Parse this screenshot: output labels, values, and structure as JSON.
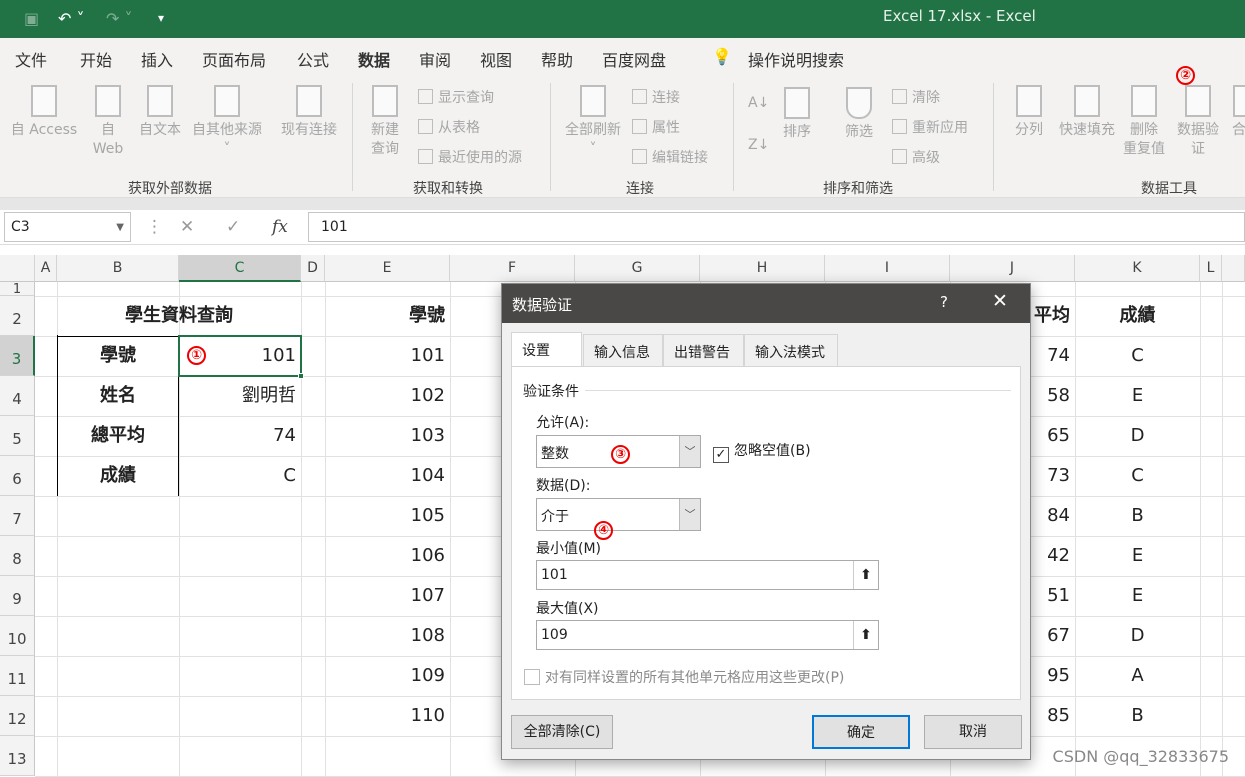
{
  "titlebar": {
    "title": "Excel 17.xlsx  -  Excel",
    "quick_access": [
      "save-icon",
      "undo-icon",
      "redo-icon",
      "customize-icon"
    ]
  },
  "menu_tabs": [
    "文件",
    "开始",
    "插入",
    "页面布局",
    "公式",
    "数据",
    "审阅",
    "视图",
    "帮助",
    "百度网盘"
  ],
  "active_tab": "数据",
  "tell_me": "操作说明搜索",
  "ribbon": {
    "get_external": {
      "label": "获取外部数据",
      "items": [
        "自 Access",
        "自\nWeb",
        "自文本",
        "自其他来源",
        "现有连接"
      ]
    },
    "get_transform": {
      "label": "获取和转换",
      "new_query": "新建\n查询",
      "small": [
        "显示查询",
        "从表格",
        "最近使用的源"
      ]
    },
    "connections": {
      "label": "连接",
      "refresh": "全部刷新",
      "small": [
        "连接",
        "属性",
        "编辑链接"
      ]
    },
    "sort_filter": {
      "label": "排序和筛选",
      "sort": "排序",
      "filter": "筛选",
      "small": [
        "清除",
        "重新应用",
        "高级"
      ]
    },
    "data_tools": {
      "label": "数据工具",
      "items": [
        "分列",
        "快速填充",
        "删除\n重复值",
        "数据验\n证",
        "合并"
      ]
    }
  },
  "formula_bar": {
    "name_box": "C3",
    "formula": "101",
    "fx": "fx"
  },
  "columns": [
    "A",
    "B",
    "C",
    "D",
    "E",
    "F",
    "G",
    "H",
    "I",
    "J",
    "K",
    "L"
  ],
  "rows": [
    "1",
    "2",
    "3",
    "4",
    "5",
    "6",
    "7",
    "8",
    "9",
    "10",
    "11",
    "12",
    "13"
  ],
  "lookup": {
    "title": "學生資料查詢",
    "labels": [
      "學號",
      "姓名",
      "總平均",
      "成績"
    ],
    "values": [
      "101",
      "劉明哲",
      "74",
      "C"
    ]
  },
  "table": {
    "header_id": "學號",
    "header_avg": "平均",
    "header_grade": "成績",
    "ids": [
      "101",
      "102",
      "103",
      "104",
      "105",
      "106",
      "107",
      "108",
      "109",
      "110"
    ],
    "avgs": [
      "74",
      "58",
      "65",
      "73",
      "84",
      "42",
      "51",
      "67",
      "95",
      "85"
    ],
    "grades": [
      "C",
      "E",
      "D",
      "C",
      "B",
      "E",
      "E",
      "D",
      "A",
      "B"
    ]
  },
  "annotations": [
    "①",
    "②",
    "③",
    "④"
  ],
  "dialog": {
    "title": "数据验证",
    "help": "?",
    "tabs": [
      "设置",
      "输入信息",
      "出错警告",
      "输入法模式"
    ],
    "section": "验证条件",
    "allow_label": "允许(A):",
    "allow_value": "整数",
    "ignore_blank": "忽略空值(B)",
    "ignore_blank_checked": true,
    "data_label": "数据(D):",
    "data_value": "介于",
    "min_label": "最小值(M)",
    "min_value": "101",
    "max_label": "最大值(X)",
    "max_value": "109",
    "apply_all": "对有同样设置的所有其他单元格应用这些更改(P)",
    "clear_all": "全部清除(C)",
    "ok": "确定",
    "cancel": "取消"
  },
  "watermark": "CSDN @qq_32833675",
  "colors": {
    "excel_green": "#217346",
    "dialog_title": "#4a4846",
    "annotation": "#e00000"
  }
}
